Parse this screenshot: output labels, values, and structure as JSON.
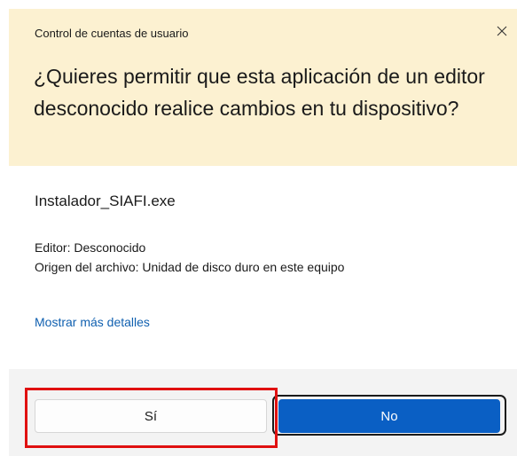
{
  "dialog": {
    "header_label": "Control de cuentas de usuario",
    "question": "¿Quieres permitir que esta aplicación de un editor desconocido realice cambios en tu dispositivo?",
    "close_icon": "close-icon"
  },
  "details": {
    "file_name": "Instalador_SIAFI.exe",
    "publisher": "Editor: Desconocido",
    "origin": "Origen del archivo: Unidad de disco duro en este equipo",
    "more_details_link": "Mostrar más detalles"
  },
  "buttons": {
    "yes_label": "Sí",
    "no_label": "No"
  },
  "colors": {
    "header_bg": "#fcf1d1",
    "footer_bg": "#f3f3f3",
    "primary_button": "#0a5fc4",
    "link": "#1060b0",
    "highlight_box": "#e01010"
  }
}
